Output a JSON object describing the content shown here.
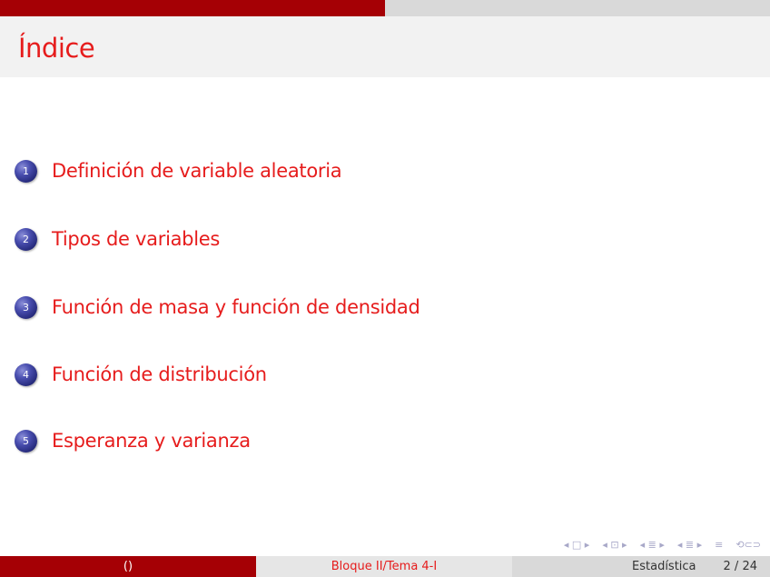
{
  "progress": {
    "fraction": 0.5
  },
  "frame": {
    "title": "Índice"
  },
  "toc": [
    {
      "number": "1",
      "label": "Definición de variable aleatoria"
    },
    {
      "number": "2",
      "label": "Tipos de variables"
    },
    {
      "number": "3",
      "label": "Función de masa y función de densidad"
    },
    {
      "number": "4",
      "label": "Función de distribución"
    },
    {
      "number": "5",
      "label": "Esperanza y varianza"
    }
  ],
  "nav": {
    "frame_nav": "◂ □ ▸",
    "subsection_nav": "◂ ⊡ ▸",
    "section_nav": "◂ ≣ ▸",
    "subsubsection_nav": "◂ ≣ ▸",
    "align": "≡",
    "search": "⟲⊂⊃"
  },
  "footer": {
    "author": "()",
    "title": "Bloque II/Tema 4-I",
    "course": "Estadística",
    "page": "2 / 24"
  }
}
